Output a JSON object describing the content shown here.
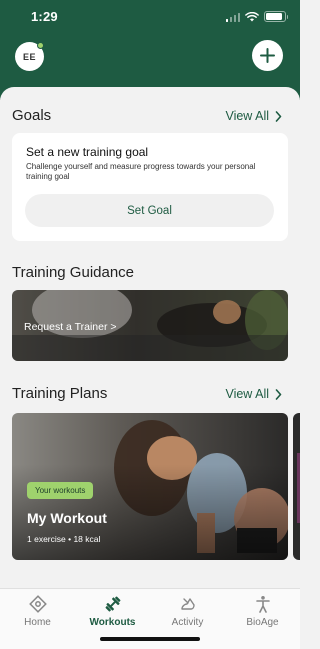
{
  "status_bar": {
    "time": "1:29"
  },
  "header": {
    "avatar_initials": "EE"
  },
  "goals": {
    "title": "Goals",
    "view_all": "View All",
    "card_title": "Set a new training goal",
    "card_description": "Challenge yourself and measure progress towards your personal training goal",
    "button_label": "Set Goal"
  },
  "training_guidance": {
    "title": "Training Guidance",
    "banner_label": "Request a Trainer >"
  },
  "training_plans": {
    "title": "Training Plans",
    "view_all": "View All",
    "card": {
      "tag": "Your workouts",
      "name": "My Workout",
      "meta": "1 exercise • 18 kcal"
    }
  },
  "tabs": [
    {
      "label": "Home",
      "icon": "home-icon",
      "active": false
    },
    {
      "label": "Workouts",
      "icon": "dumbbell-icon",
      "active": true
    },
    {
      "label": "Activity",
      "icon": "activity-icon",
      "active": false
    },
    {
      "label": "BioAge",
      "icon": "bioage-icon",
      "active": false
    }
  ],
  "colors": {
    "brand": "#1e5b42",
    "accent": "#9fd26d",
    "background": "#f2f2f2"
  }
}
